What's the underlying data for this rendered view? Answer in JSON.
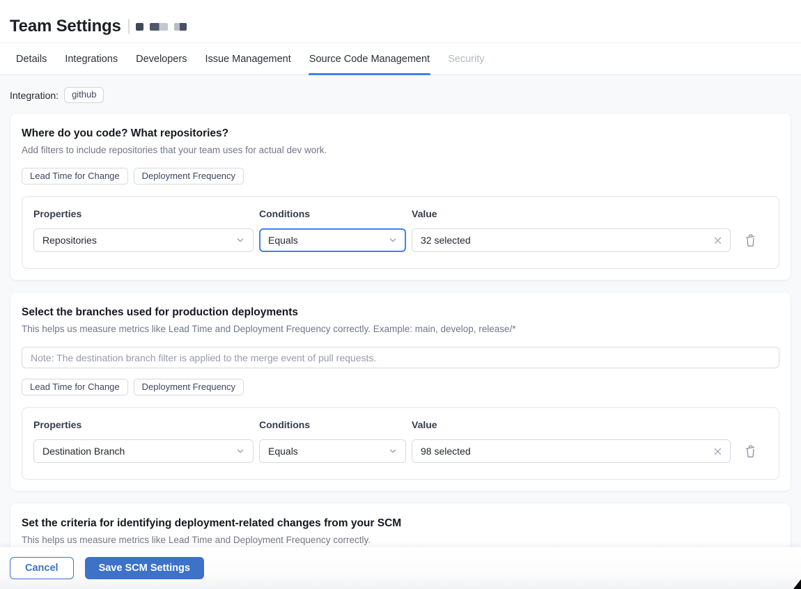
{
  "page": {
    "title": "Team Settings"
  },
  "tabs": {
    "items": [
      {
        "label": "Details",
        "state": "normal"
      },
      {
        "label": "Integrations",
        "state": "normal"
      },
      {
        "label": "Developers",
        "state": "normal"
      },
      {
        "label": "Issue Management",
        "state": "normal"
      },
      {
        "label": "Source Code Management",
        "state": "active"
      },
      {
        "label": "Security",
        "state": "disabled"
      }
    ]
  },
  "integration": {
    "label": "Integration:",
    "badge": "github"
  },
  "repositories_card": {
    "title": "Where do you code? What repositories?",
    "subtitle": "Add filters to include repositories that your team uses for actual dev work.",
    "badges": [
      "Lead Time for Change",
      "Deployment Frequency"
    ],
    "filter": {
      "properties_label": "Properties",
      "conditions_label": "Conditions",
      "value_label": "Value",
      "property_value": "Repositories",
      "condition_value": "Equals",
      "value_text": "32 selected"
    }
  },
  "branches_card": {
    "title": "Select the branches used for production deployments",
    "subtitle": "This helps us measure metrics like Lead Time and Deployment Frequency correctly. Example: main, develop, release/*",
    "note_placeholder": "Note: The destination branch filter is applied to the merge event of pull requests.",
    "badges": [
      "Lead Time for Change",
      "Deployment Frequency"
    ],
    "filter": {
      "properties_label": "Properties",
      "conditions_label": "Conditions",
      "value_label": "Value",
      "property_value": "Destination Branch",
      "condition_value": "Equals",
      "value_text": "98 selected"
    }
  },
  "deployment_card": {
    "title": "Set the criteria for identifying deployment-related changes from your SCM",
    "subtitle": "This helps us measure metrics like Lead Time and Deployment Frequency correctly."
  },
  "footer": {
    "cancel_label": "Cancel",
    "save_label": "Save SCM Settings"
  },
  "colors": {
    "accent": "#3b82f6",
    "primary_button": "#3d72c8",
    "disabled_tab": "#b4b9c4"
  }
}
